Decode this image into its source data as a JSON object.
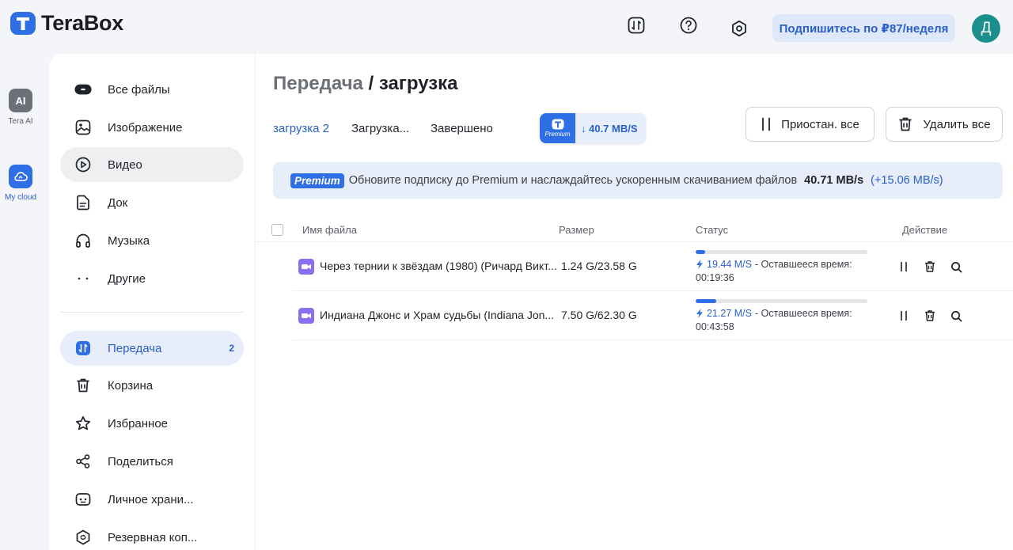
{
  "app": {
    "name": "TeraBox"
  },
  "header": {
    "subscribe_label": "Подпишитесь по ₽87/неделя",
    "avatar_letter": "Д",
    "icons": [
      "transfer-icon",
      "help-icon",
      "settings-icon"
    ]
  },
  "rail": {
    "items": [
      {
        "label": "Tera AI",
        "icon_text": "AI",
        "icon": "tera-ai-icon"
      },
      {
        "label": "My cloud",
        "icon": "cloud-icon"
      }
    ]
  },
  "sidebar": {
    "items": [
      {
        "label": "Все файлы",
        "icon": "all-files-icon"
      },
      {
        "label": "Изображение",
        "icon": "image-icon"
      },
      {
        "label": "Видео",
        "icon": "video-icon"
      },
      {
        "label": "Док",
        "icon": "document-icon"
      },
      {
        "label": "Музыка",
        "icon": "headphones-icon"
      },
      {
        "label": "Другие",
        "icon": "more-dots-icon"
      },
      {
        "label": "Передача",
        "icon": "transfer-icon",
        "badge": "2"
      },
      {
        "label": "Корзина",
        "icon": "trash-icon"
      },
      {
        "label": "Избранное",
        "icon": "star-icon"
      },
      {
        "label": "Поделиться",
        "icon": "share-icon"
      },
      {
        "label": "Личное храни...",
        "icon": "private-storage-icon"
      },
      {
        "label": "Резервная коп...",
        "icon": "backup-icon"
      }
    ]
  },
  "main": {
    "breadcrumb": {
      "root": "Передача",
      "sep": "/",
      "current": "загрузка"
    },
    "tabs": [
      {
        "label": "загрузка 2"
      },
      {
        "label": "Загрузка..."
      },
      {
        "label": "Завершено"
      }
    ],
    "speed_badge": {
      "premium_label": "Premium",
      "speed": "↓ 40.7 MB/S"
    },
    "pause_all_label": "Приостан. все",
    "delete_all_label": "Удалить все",
    "promo": {
      "badge": "Premium",
      "text": "Обновите подписку до Premium и наслаждайтесь ускоренным скачиванием файлов",
      "speed": "40.71 MB/s",
      "plus": "(+15.06 MB/s)"
    },
    "table": {
      "columns": [
        "Имя файла",
        "Размер",
        "Статус",
        "Действие"
      ],
      "rows": [
        {
          "name": "Через тернии к звёздам (1980) (Ричард Викт...",
          "size": "1.24 G/23.58 G",
          "progress": 0.053,
          "speed": "19.44 M/S",
          "remaining_label": "- Оставшееся время:",
          "time": "00:19:36"
        },
        {
          "name": "Индиана Джонс и Храм судьбы (Indiana Jon...",
          "size": "7.50 G/62.30 G",
          "progress": 0.12,
          "speed": "21.27 M/S",
          "remaining_label": "- Оставшееся время:",
          "time": "00:43:58"
        }
      ]
    }
  },
  "colors": {
    "accent": "#2f6fe6",
    "avatar": "#1a8f8c"
  }
}
